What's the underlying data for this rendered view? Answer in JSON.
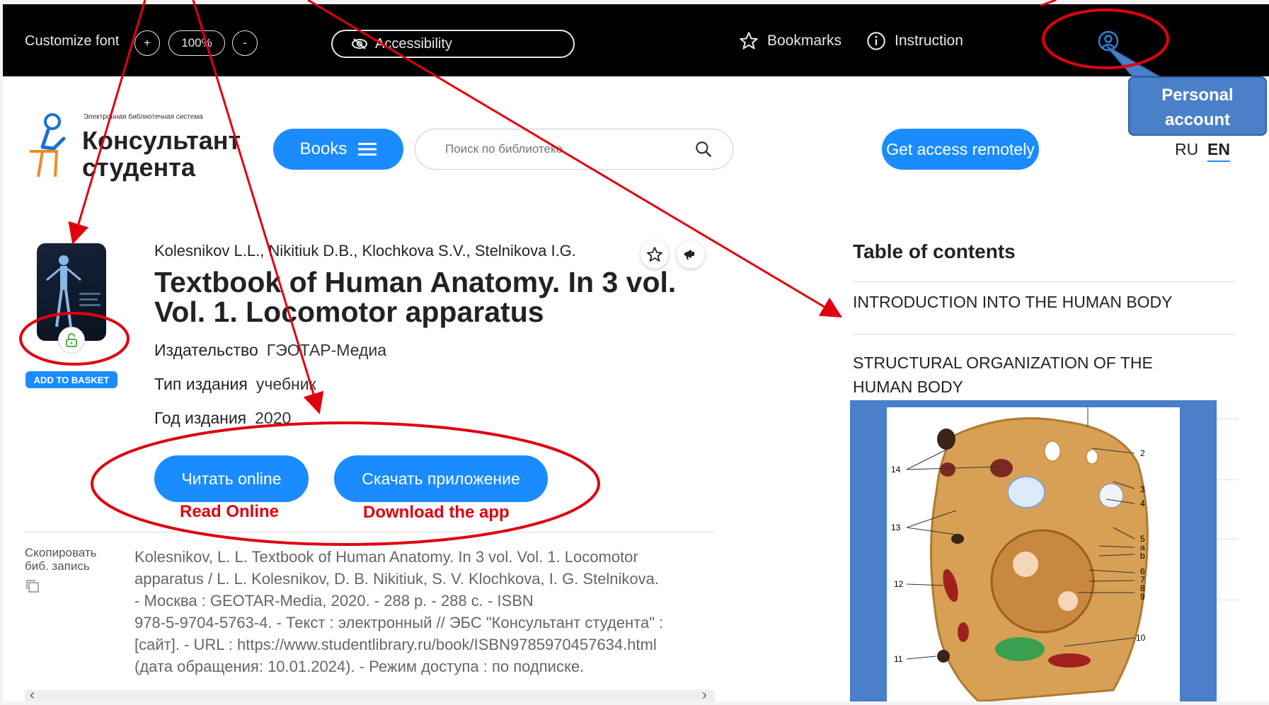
{
  "topbar": {
    "font_label": "Customize font",
    "font_plus": "+",
    "font_size": "100%",
    "font_minus": "-",
    "accessibility": "Accessibility",
    "bookmarks": "Bookmarks",
    "instruction": "Instruction"
  },
  "logo": {
    "small": "Электронная библиотечная система",
    "line1": "Консультант",
    "line2": "студента"
  },
  "nav": {
    "books": "Books",
    "search_placeholder": "Поиск по библиотеке",
    "remote": "Get access remotely",
    "lang_ru": "RU",
    "lang_en": "EN"
  },
  "book": {
    "basket": "ADD TO BASKET",
    "authors": "Kolesnikov L.L., Nikitiuk D.B., Klochkova S.V., Stelnikova I.G.",
    "title_line1": "Textbook of Human Anatomy. In 3 vol.",
    "title_line2": "Vol. 1. Locomotor apparatus",
    "publisher_label": "Издательство",
    "publisher": "ГЭОТАР-Медиа",
    "type_label": "Тип издания",
    "type": "учебник",
    "year_label": "Год издания",
    "year": "2020",
    "read_btn": "Читать online",
    "download_btn": "Скачать приложение",
    "copy_label_1": "Скопировать",
    "copy_label_2": "биб. запись",
    "bib": [
      "Kolesnikov, L. L. Textbook of Human Anatomy. In 3 vol. Vol. 1. Locomotor",
      "apparatus / L. L. Kolesnikov, D. B. Nikitiuk, S. V. Klochkova, I. G. Stelnikova.",
      "- Москва : GEOTAR-Media, 2020. - 288 p. - 288 с. - ISBN",
      "978-5-9704-5763-4. - Текст : электронный // ЭБС \"Консультант студента\" :",
      "[сайт]. - URL : https://www.studentlibrary.ru/book/ISBN9785970457634.html",
      "(дата обращения: 10.01.2024). - Режим доступа : по подписке."
    ]
  },
  "toc": {
    "title": "Table of contents",
    "items": [
      "INTRODUCTION INTO THE HUMAN BODY",
      "STRUCTURAL ORGANIZATION OF THE HUMAN BODY"
    ]
  },
  "annotations": {
    "personal_account": "Personal account",
    "read_online": "Read Online",
    "download_app": "Download the app",
    "cell_labels": [
      "2",
      "3",
      "4",
      "5",
      "a",
      "b",
      "6",
      "7",
      "8",
      "9",
      "10",
      "11",
      "12",
      "13",
      "14"
    ]
  },
  "colors": {
    "accent": "#1a8cff",
    "annotation": "#e0000f",
    "callout": "#4a7fc9"
  }
}
